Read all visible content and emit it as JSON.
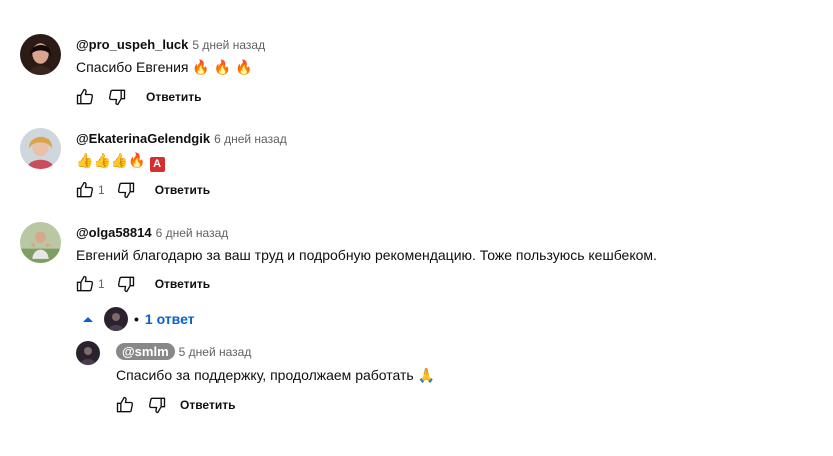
{
  "comments": [
    {
      "author": "@pro_uspeh_luck",
      "time": "5 дней назад",
      "text": "Спасибо Евгения",
      "emojis": [
        "🔥",
        "🔥",
        "🔥"
      ],
      "likes": "",
      "reply_label": "Ответить"
    },
    {
      "author": "@EkaterinaGelendgik",
      "time": "6 дней назад",
      "text": "",
      "emojis": [
        "👍",
        "👍",
        "👍",
        "🔥"
      ],
      "badge": "A",
      "likes": "1",
      "reply_label": "Ответить"
    },
    {
      "author": "@olga58814",
      "time": "6 дней назад",
      "text": "Евгений благодарю за ваш труд и подробную рекомендацию. Тоже пользуюсь кешбеком.",
      "likes": "1",
      "reply_label": "Ответить",
      "replies_toggle": "1 ответ",
      "replies_separator": "•"
    }
  ],
  "reply": {
    "author": "@smlm",
    "time": "5 дней назад",
    "text": "Спасибо за поддержку, продолжаем работать",
    "emoji": "🙏",
    "reply_label": "Ответить"
  },
  "colors": {
    "link_blue": "#065fd4",
    "muted": "#606060",
    "author_pill": "#888888"
  },
  "icons": [
    "thumbs-up-icon",
    "thumbs-down-icon",
    "caret-up-icon"
  ]
}
